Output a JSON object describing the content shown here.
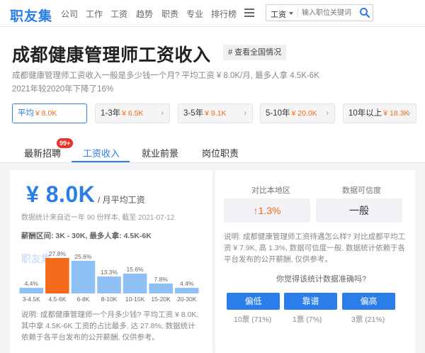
{
  "nav": {
    "logo": "职友集",
    "items": [
      "公司",
      "工作",
      "工资",
      "趋势",
      "职责",
      "专业",
      "排行榜"
    ],
    "search_select": "工资",
    "search_placeholder": "输入职位关键词"
  },
  "header": {
    "title": "成都健康管理师工资收入",
    "national_link": "# 查看全国情况",
    "desc_line1": "成都健康管理师工资收入一般是多少钱一个月? 平均工资 ¥ 8.0K/月, 最多人拿 4.5K-6K",
    "desc_line2": "2021年较2020年下降了16%"
  },
  "experience": [
    {
      "label": "平均",
      "value": "¥ 8.0K",
      "active": true
    },
    {
      "label": "1-3年",
      "value": "¥ 6.5K",
      "active": false
    },
    {
      "label": "3-5年",
      "value": "¥ 9.1K",
      "active": false
    },
    {
      "label": "5-10年",
      "value": "¥ 20.0K",
      "active": false
    },
    {
      "label": "10年以上",
      "value": "¥ 18.3K",
      "active": false
    }
  ],
  "tabs": {
    "items": [
      "最新招聘",
      "工资收入",
      "就业前景",
      "岗位职责"
    ],
    "badge": "99+",
    "active_index": 1
  },
  "salary": {
    "big_value": "¥ 8.0K",
    "unit": "/ 月平均工资",
    "stat_note": "数据统计来自近一年 90 份样本, 截至 2021-07-12",
    "range_note": "薪酬区间: 3K - 30K, 最多人拿: 4.5K-6K",
    "watermark": "职友集",
    "bottom_note": "说明: 成都健康管理师一个月多少钱? 平均工资 ¥ 8.0K, 其中拿 4.5K-6K 工资的占比最多, 达 27.8%, 数据统计依赖于各平台发布的公开薪酬, 仅供参考。"
  },
  "chart_data": {
    "type": "bar",
    "categories": [
      "3-4.5K",
      "4.5-6K",
      "6-8K",
      "8-10K",
      "10-15K",
      "15-20K",
      "20-30K"
    ],
    "values": [
      4.4,
      27.8,
      25.6,
      13.3,
      15.6,
      7.8,
      4.4
    ],
    "value_labels": [
      "4.4%",
      "27.8%",
      "25.6%",
      "13.3%",
      "15.6%",
      "7.8%",
      "4.4%"
    ],
    "highlight_index": 1,
    "colors": {
      "normal": "#8fc0f5",
      "highlight": "#f56a1a"
    }
  },
  "compare": {
    "label_local": "对比本地区",
    "label_confidence": "数据可信度",
    "local_arrow": "↑",
    "local_value": "1.3%",
    "confidence_value": "一般",
    "note": "说明: 成都健康管理师工资待遇怎么样? 对比成都平均工资 ¥ 7.9K, 高 1.3%, 数据可信度一般, 数据统计依赖于各平台发布的公开薪酬, 仅供参考。",
    "question": "你觉得该统计数据准确吗?",
    "votes": [
      {
        "label": "偏低",
        "count": "10票 (71%)"
      },
      {
        "label": "靠谱",
        "count": "1票 (7%)"
      },
      {
        "label": "偏高",
        "count": "3票 (21%)"
      }
    ]
  },
  "colors": {
    "brand": "#2b7de9",
    "accent": "#f56a1a",
    "badge": "#e8332c"
  }
}
